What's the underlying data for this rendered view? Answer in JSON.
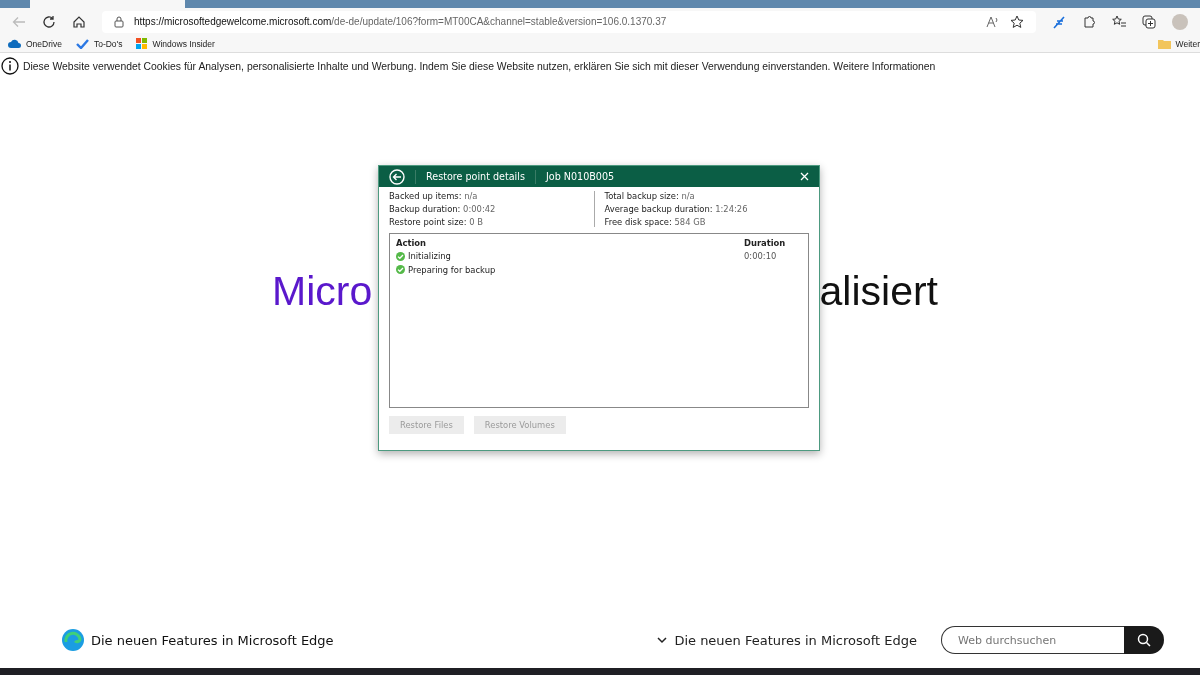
{
  "browser": {
    "url_host": "https://microsoftedgewelcome.microsoft.com",
    "url_path": "/de-de/update/106?form=MT00CA&channel=stable&version=106.0.1370.37",
    "bookmarks": [
      "OneDrive",
      "To-Do's",
      "Windows Insider"
    ],
    "other_favorites": "Weiter"
  },
  "cookie_notice": {
    "text": "Diese Website verwendet Cookies für Analysen, personalisierte Inhalte und Werbung. Indem Sie diese Website nutzen, erklären Sie sich mit dieser Verwendung einverstanden.",
    "link": "Weitere Informationen"
  },
  "headline": {
    "left_part": "Micro",
    "right_part": "alisiert"
  },
  "dialog": {
    "title": "Restore point details",
    "job": "Job N010B005",
    "stats_left": [
      {
        "label": "Backed up items:",
        "value": "n/a"
      },
      {
        "label": "Backup duration:",
        "value": "0:00:42"
      },
      {
        "label": "Restore point size:",
        "value": "0 B"
      }
    ],
    "stats_right": [
      {
        "label": "Total backup size:",
        "value": "n/a"
      },
      {
        "label": "Average backup duration:",
        "value": "1:24:26"
      },
      {
        "label": "Free disk space:",
        "value": "584 GB"
      }
    ],
    "columns": [
      "Action",
      "Duration"
    ],
    "rows": [
      {
        "action": "Initializing",
        "duration": "0:00:10"
      },
      {
        "action": "Preparing for backup"
      }
    ],
    "buttons": [
      {
        "label": "Restore Files",
        "disabled": true
      },
      {
        "label": "Restore Volumes",
        "disabled": true
      }
    ]
  },
  "footer": {
    "brand": "Die neuen Features in Microsoft Edge",
    "menu": "Die neuen Features in Microsoft Edge",
    "search_placeholder": "Web durchsuchen"
  }
}
